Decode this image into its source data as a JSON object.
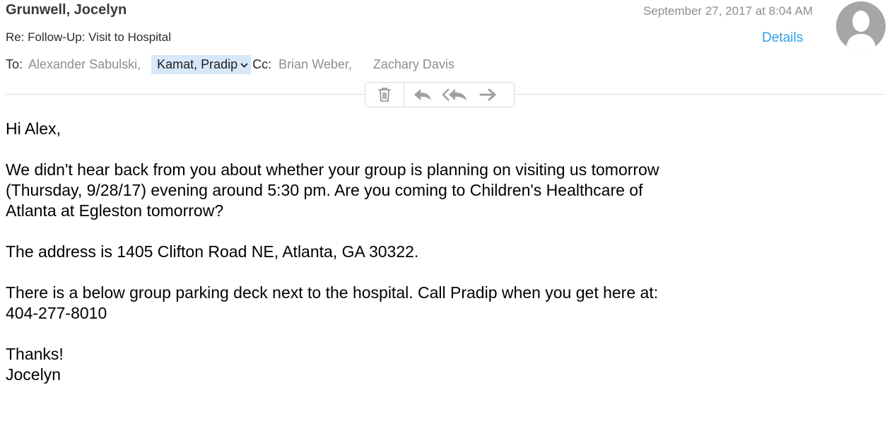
{
  "message": {
    "sender": "Grunwell, Jocelyn",
    "date": "September 27, 2017 at 8:04 AM",
    "details_label": "Details",
    "subject": "Re: Follow-Up: Visit to Hospital",
    "to_label": "To:",
    "to": [
      "Alexander Sabulski,",
      "Kamat, Pradip"
    ],
    "cc_label": "Cc:",
    "cc": [
      "Brian Weber,",
      "Zachary Davis"
    ]
  },
  "toolbar": {
    "icons": [
      "trash-icon",
      "reply-icon",
      "reply-all-icon",
      "forward-icon"
    ]
  },
  "body": {
    "greeting": "Hi Alex,",
    "paragraph1": "We didn't hear back from you about whether your group is planning on visiting us tomorrow\n(Thursday, 9/28/17) evening around 5:30 pm.  Are you coming to Children's Healthcare of\nAtlanta at Egleston tomorrow?",
    "paragraph2": "The address is 1405 Clifton Road NE, Atlanta, GA 30322.",
    "paragraph3": "There is a below group parking deck next to the hospital.  Call Pradip when you get here at:\n404-277-8010",
    "signoff": "Thanks!\nJocelyn"
  },
  "colors": {
    "link": "#2f9fe8",
    "selected_chip": "#d7e8f8",
    "muted_text": "#8e8e93",
    "avatar": "#a6a6a8"
  }
}
